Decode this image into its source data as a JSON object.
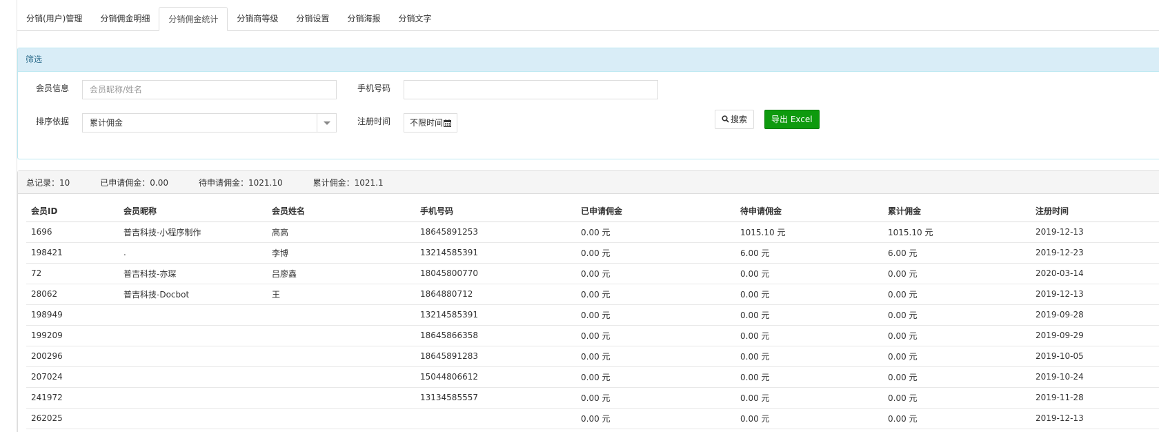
{
  "tabs": [
    {
      "label": "分销(用户)管理"
    },
    {
      "label": "分销佣金明细"
    },
    {
      "label": "分销佣金统计"
    },
    {
      "label": "分销商等级"
    },
    {
      "label": "分销设置"
    },
    {
      "label": "分销海报"
    },
    {
      "label": "分销文字"
    }
  ],
  "active_tab": "分销佣金统计",
  "filter": {
    "title": "筛选",
    "member_info_label": "会员信息",
    "member_info_placeholder": "会员昵称/姓名",
    "member_info_value": "",
    "phone_label": "手机号码",
    "phone_value": "",
    "sort_label": "排序依据",
    "sort_value": "累计佣金",
    "register_label": "注册时间",
    "register_value": "不限时间",
    "search_button": "搜索",
    "export_button": "导出 Excel"
  },
  "summary": {
    "total_records": "总记录：10",
    "applied": "已申请佣金：0.00",
    "pending": "待申请佣金：1021.10",
    "cumulative": "累计佣金：1021.1"
  },
  "table": {
    "headers": [
      "会员ID",
      "会员昵称",
      "会员姓名",
      "手机号码",
      "已申请佣金",
      "待申请佣金",
      "累计佣金",
      "注册时间"
    ],
    "rows": [
      [
        "1696",
        "普吉科技-小程序制作",
        "高高",
        "18645891253",
        "0.00 元",
        "1015.10 元",
        "1015.10 元",
        "2019-12-13"
      ],
      [
        "198421",
        ".",
        "李博",
        "13214585391",
        "0.00 元",
        "6.00 元",
        "6.00 元",
        "2019-12-23"
      ],
      [
        "72",
        "普吉科技-亦琛",
        "吕廖鑫",
        "18045800770",
        "0.00 元",
        "0.00 元",
        "0.00 元",
        "2020-03-14"
      ],
      [
        "28062",
        "普吉科技-Docbot",
        "王",
        "1864880712",
        "0.00 元",
        "0.00 元",
        "0.00 元",
        "2019-12-13"
      ],
      [
        "198949",
        "",
        "",
        "13214585391",
        "0.00 元",
        "0.00 元",
        "0.00 元",
        "2019-09-28"
      ],
      [
        "199209",
        "",
        "",
        "18645866358",
        "0.00 元",
        "0.00 元",
        "0.00 元",
        "2019-09-29"
      ],
      [
        "200296",
        "",
        "",
        "18645891283",
        "0.00 元",
        "0.00 元",
        "0.00 元",
        "2019-10-05"
      ],
      [
        "207024",
        "",
        "",
        "15044806612",
        "0.00 元",
        "0.00 元",
        "0.00 元",
        "2019-10-24"
      ],
      [
        "241972",
        "",
        "",
        "13134585557",
        "0.00 元",
        "0.00 元",
        "0.00 元",
        "2019-11-28"
      ],
      [
        "262025",
        "",
        "",
        "",
        "0.00 元",
        "0.00 元",
        "0.00 元",
        "2019-12-13"
      ]
    ]
  },
  "colors": {
    "panel_header_bg": "#d9edf7",
    "panel_header_text": "#31708f",
    "export_button_bg": "#0e9a0e"
  }
}
